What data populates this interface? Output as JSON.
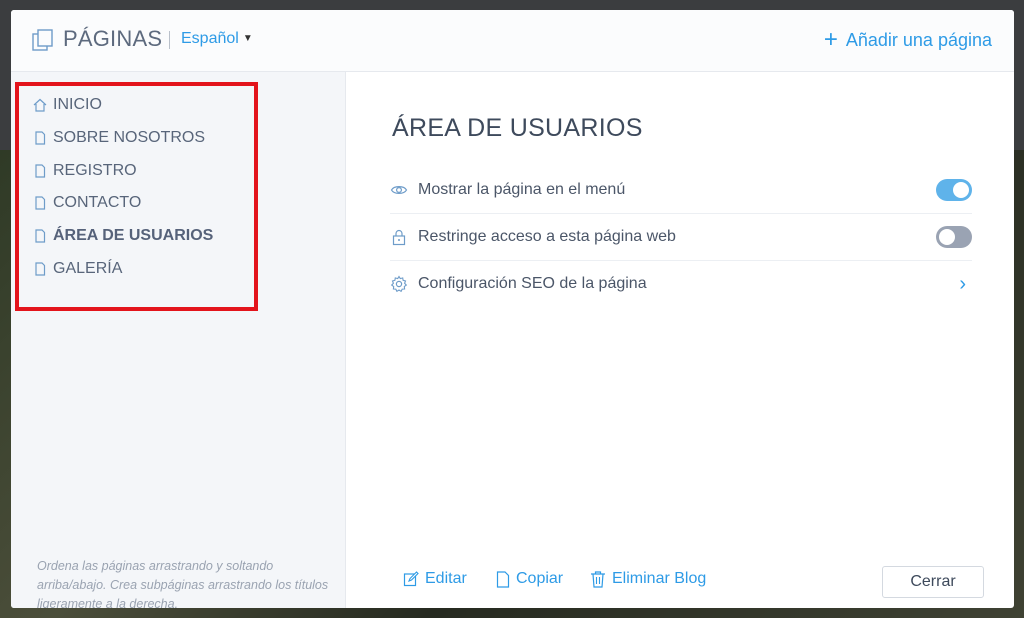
{
  "header": {
    "title": "PÁGINAS",
    "language": "Español",
    "add_page_label": "Añadir una página"
  },
  "sidebar": {
    "items": [
      {
        "label": "INICIO",
        "icon": "home-icon"
      },
      {
        "label": "SOBRE NOSOTROS",
        "icon": "page-icon"
      },
      {
        "label": "REGISTRO",
        "icon": "page-icon"
      },
      {
        "label": "CONTACTO",
        "icon": "page-icon"
      },
      {
        "label": "ÁREA DE USUARIOS",
        "icon": "page-icon",
        "active": true
      },
      {
        "label": "GALERÍA",
        "icon": "page-icon"
      }
    ],
    "hint": "Ordena las páginas arrastrando y soltando arriba/abajo. Crea subpáginas arrastrando los títulos ligeramente a la derecha."
  },
  "main": {
    "title": "ÁREA DE USUARIOS",
    "settings": [
      {
        "label": "Mostrar la página en el menú",
        "icon": "eye-icon",
        "type": "toggle",
        "value": true
      },
      {
        "label": "Restringe acceso a esta página web",
        "icon": "lock-icon",
        "type": "toggle",
        "value": false
      },
      {
        "label": "Configuración SEO de la página",
        "icon": "gear-icon",
        "type": "link"
      }
    ],
    "actions": {
      "edit": "Editar",
      "copy": "Copiar",
      "delete": "Eliminar Blog",
      "close": "Cerrar"
    }
  },
  "colors": {
    "accent": "#2e9be6",
    "highlight": "#e3141c",
    "toggle_on": "#5fb3ea",
    "toggle_off": "#9aa3b3"
  }
}
